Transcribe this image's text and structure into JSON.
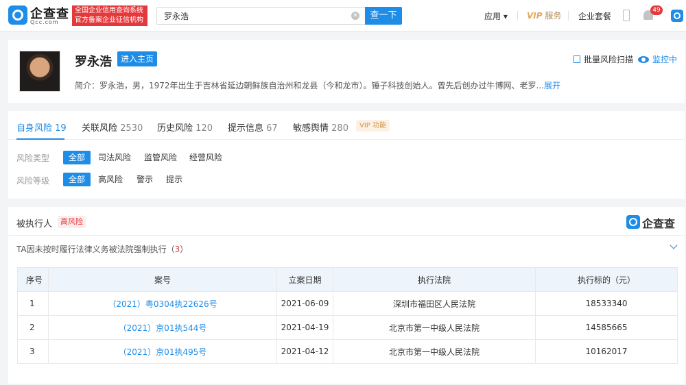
{
  "header": {
    "logo_cn": "企查查",
    "logo_en": "Qcc.com",
    "badge_line1": "全国企业信用查询系统",
    "badge_line2": "官方备案企业征信机构",
    "search_value": "罗永浩",
    "search_button": "查一下",
    "nav_app": "应用 ▾",
    "nav_vip_prefix": "VIP",
    "nav_vip_suffix": "服务",
    "nav_package": "企业套餐",
    "notification_count": "49"
  },
  "profile": {
    "name": "罗永浩",
    "enter_button": "进入主页",
    "bio_text": "简介：罗永浩，男，1972年出生于吉林省延边朝鲜族自治州和龙县（今和龙市）。锤子科技创始人。曾先后创办过牛博网、老罗...",
    "bio_more": "展开",
    "batch_scan": "批量风险扫描",
    "monitor": "监控中"
  },
  "tabs": [
    {
      "label": "自身风险",
      "count": "19"
    },
    {
      "label": "关联风险",
      "count": "2530"
    },
    {
      "label": "历史风险",
      "count": "120"
    },
    {
      "label": "提示信息",
      "count": "67"
    },
    {
      "label": "敏感舆情",
      "count": "280"
    }
  ],
  "vip_tag": "VIP 功能",
  "filters": {
    "type_label": "风险类型",
    "type_options": [
      "全部",
      "司法风险",
      "监管风险",
      "经营风险"
    ],
    "level_label": "风险等级",
    "level_options": [
      "全部",
      "高风险",
      "警示",
      "提示"
    ]
  },
  "section": {
    "title": "被执行人",
    "risk_tag": "高风险",
    "watermark": "企查查",
    "subtitle": "TA因未按时履行法律义务被法院强制执行",
    "count": "3"
  },
  "table": {
    "headers": [
      "序号",
      "案号",
      "立案日期",
      "执行法院",
      "执行标的（元）"
    ],
    "rows": [
      [
        "1",
        "（2021）粤0304执22626号",
        "2021-06-09",
        "深圳市福田区人民法院",
        "18533340"
      ],
      [
        "2",
        "（2021）京01执544号",
        "2021-04-19",
        "北京市第一中级人民法院",
        "14585665"
      ],
      [
        "3",
        "（2021）京01执495号",
        "2021-04-12",
        "北京市第一中级人民法院",
        "10162017"
      ]
    ]
  },
  "colors": {
    "accent": "#1e8de8",
    "danger": "#e4393c",
    "vip": "#c9954d"
  }
}
